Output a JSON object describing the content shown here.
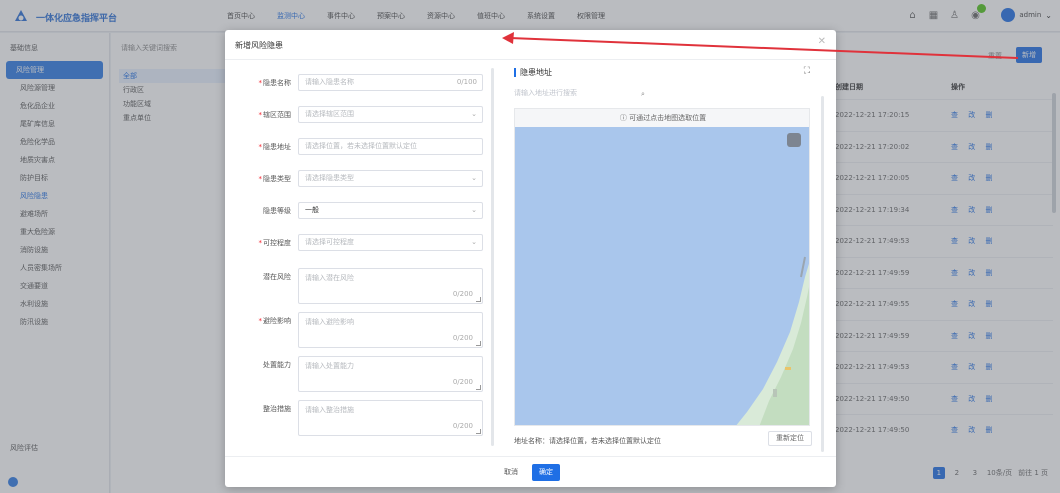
{
  "app": {
    "title": "一体化应急指挥平台"
  },
  "topnav": [
    {
      "label": "首页中心",
      "active": false
    },
    {
      "label": "监测中心",
      "active": true
    },
    {
      "label": "事件中心",
      "active": false
    },
    {
      "label": "预案中心",
      "active": false
    },
    {
      "label": "资源中心",
      "active": false
    },
    {
      "label": "值班中心",
      "active": false
    },
    {
      "label": "系统设置",
      "active": false
    },
    {
      "label": "权限管理",
      "active": false
    }
  ],
  "user": {
    "name": "admin"
  },
  "sidebar": {
    "header": "基础信息",
    "group": "风险管理",
    "items": [
      {
        "label": "风险源管理",
        "active": false
      },
      {
        "label": "危化品企业",
        "active": false
      },
      {
        "label": "尾矿库信息",
        "active": false
      },
      {
        "label": "危险化学品",
        "active": false
      },
      {
        "label": "地质灾害点",
        "active": false
      },
      {
        "label": "防护目标",
        "active": false
      },
      {
        "label": "风险隐患",
        "active": true
      },
      {
        "label": "避难场所",
        "active": false
      },
      {
        "label": "重大危险源",
        "active": false
      },
      {
        "label": "消防设施",
        "active": false
      },
      {
        "label": "人员密集场所",
        "active": false
      },
      {
        "label": "交通要道",
        "active": false
      },
      {
        "label": "水利设施",
        "active": false
      },
      {
        "label": "防汛设施",
        "active": false
      }
    ],
    "footer": "风险评估"
  },
  "background": {
    "filter_label": "请输入关键词搜索",
    "tree": [
      {
        "label": "全部",
        "selected": true
      },
      {
        "label": "行政区",
        "selected": false
      },
      {
        "label": "功能区域",
        "selected": false
      },
      {
        "label": "重点单位",
        "selected": false
      }
    ],
    "reset_label": "重置",
    "add_label": "新增",
    "table_headers": [
      "创建日期",
      "操作"
    ],
    "table_rows": [
      {
        "date": "2022-12-21 17:20:15",
        "ops": "查 改 删"
      },
      {
        "date": "2022-12-21 17:20:02",
        "ops": "查 改 删"
      },
      {
        "date": "2022-12-21 17:20:05",
        "ops": "查 改 删"
      },
      {
        "date": "2022-12-21 17:19:34",
        "ops": "查 改 删"
      },
      {
        "date": "2022-12-21 17:49:53",
        "ops": "查 改 删"
      },
      {
        "date": "2022-12-21 17:49:59",
        "ops": "查 改 删"
      },
      {
        "date": "2022-12-21 17:49:55",
        "ops": "查 改 删"
      },
      {
        "date": "2022-12-21 17:49:59",
        "ops": "查 改 删"
      },
      {
        "date": "2022-12-21 17:49:53",
        "ops": "查 改 删"
      },
      {
        "date": "2022-12-21 17:49:50",
        "ops": "查 改 删"
      },
      {
        "date": "2022-12-21 17:49:50",
        "ops": "查 改 删"
      }
    ],
    "pager": {
      "pages": [
        "1",
        "2",
        "3"
      ],
      "current": "1",
      "page_size": "10条/页",
      "jump": "前往 1 页"
    }
  },
  "modal": {
    "title": "新增风险隐患",
    "fields": [
      {
        "label": "隐患名称",
        "required": true,
        "type": "input",
        "placeholder": "请输入隐患名称",
        "value": "",
        "count": "0/100"
      },
      {
        "label": "辖区范围",
        "required": true,
        "type": "select",
        "placeholder": "请选择辖区范围",
        "value": ""
      },
      {
        "label": "隐患地址",
        "required": true,
        "type": "input",
        "placeholder": "请选择位置，若未选择位置默认定位",
        "value": ""
      },
      {
        "label": "隐患类型",
        "required": true,
        "type": "select",
        "placeholder": "请选择隐患类型",
        "value": ""
      },
      {
        "label": "隐患等级",
        "required": false,
        "type": "select",
        "placeholder": "",
        "value": "一般"
      },
      {
        "label": "可控程度",
        "required": true,
        "type": "select",
        "placeholder": "请选择可控程度",
        "value": ""
      },
      {
        "label": "潜在风险",
        "required": false,
        "type": "textarea",
        "placeholder": "请输入潜在风险",
        "value": "",
        "count": "0/200"
      },
      {
        "label": "避险影响",
        "required": true,
        "type": "textarea",
        "placeholder": "请输入避险影响",
        "value": "",
        "count": "0/200"
      },
      {
        "label": "处置能力",
        "required": false,
        "type": "textarea",
        "placeholder": "请输入处置能力",
        "value": "",
        "count": "0/200"
      },
      {
        "label": "整治措施",
        "required": false,
        "type": "textarea",
        "placeholder": "请输入整治措施",
        "value": "",
        "count": "0/200"
      }
    ],
    "map": {
      "title": "隐患地址",
      "search_placeholder": "请输入地址进行搜索",
      "hint": "可通过点击地图选取位置",
      "address": "地址名称：请选择位置，若未选择位置默认定位",
      "locate_label": "重新定位"
    },
    "cancel_label": "取消",
    "ok_label": "确定"
  },
  "colors": {
    "primary": "#1f6fe5",
    "water": "#a9c6ec",
    "land": "#d9ead8",
    "annotation": "#e0323b"
  }
}
